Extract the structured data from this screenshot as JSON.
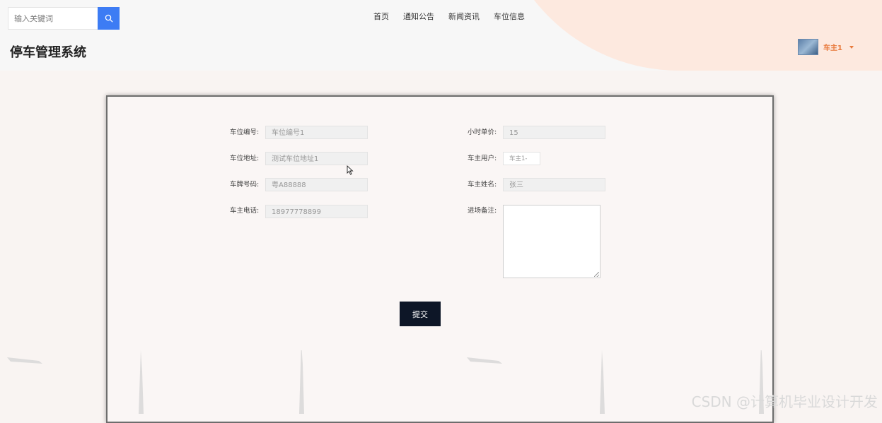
{
  "header": {
    "search_placeholder": "输入关键词",
    "brand": "停车管理系统",
    "nav": [
      "首页",
      "通知公告",
      "新闻资讯",
      "车位信息"
    ],
    "user_name": "车主1"
  },
  "form": {
    "left": [
      {
        "label": "车位编号:",
        "value": "车位编号1"
      },
      {
        "label": "车位地址:",
        "value": "测试车位地址1"
      },
      {
        "label": "车牌号码:",
        "value": "粤A88888"
      },
      {
        "label": "车主电话:",
        "value": "18977778899"
      }
    ],
    "right": [
      {
        "label": "小时单价:",
        "value": "15"
      },
      {
        "label": "车主用户:",
        "value": "车主1-"
      },
      {
        "label": "车主姓名:",
        "value": "张三"
      },
      {
        "label": "进场备注:",
        "value": ""
      }
    ],
    "submit_label": "提交"
  },
  "watermark": "CSDN @计算机毕业设计开发",
  "colors": {
    "accent_blue": "#3d7cf4",
    "user_orange": "#e8793c",
    "submit_bg": "#0d1627",
    "peach": "#fde9df"
  }
}
